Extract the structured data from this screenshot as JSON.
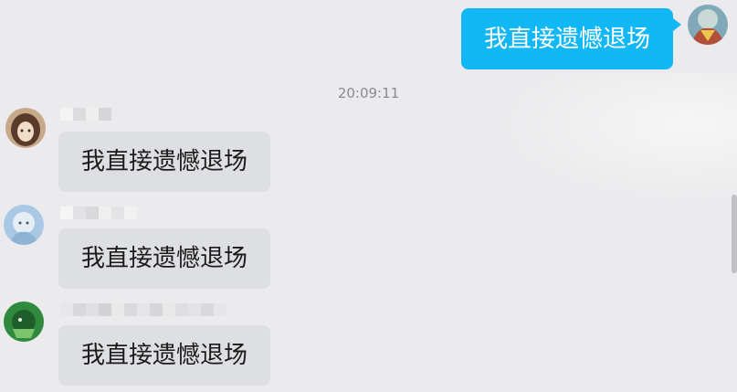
{
  "chat": {
    "timestamp": "20:09:11",
    "messages": [
      {
        "sender": "self",
        "text": "我直接遗憾退场"
      },
      {
        "sender": "member-1",
        "text": "我直接遗憾退场"
      },
      {
        "sender": "member-2",
        "text": "我直接遗憾退场"
      },
      {
        "sender": "member-3",
        "text": "我直接遗憾退场"
      }
    ]
  },
  "colors": {
    "self_bubble": "#12b7f5",
    "other_bubble": "#dedfe2",
    "background": "#ebebed"
  },
  "icons": {
    "self_avatar": "user-avatar",
    "member_avatar": "user-avatar"
  }
}
